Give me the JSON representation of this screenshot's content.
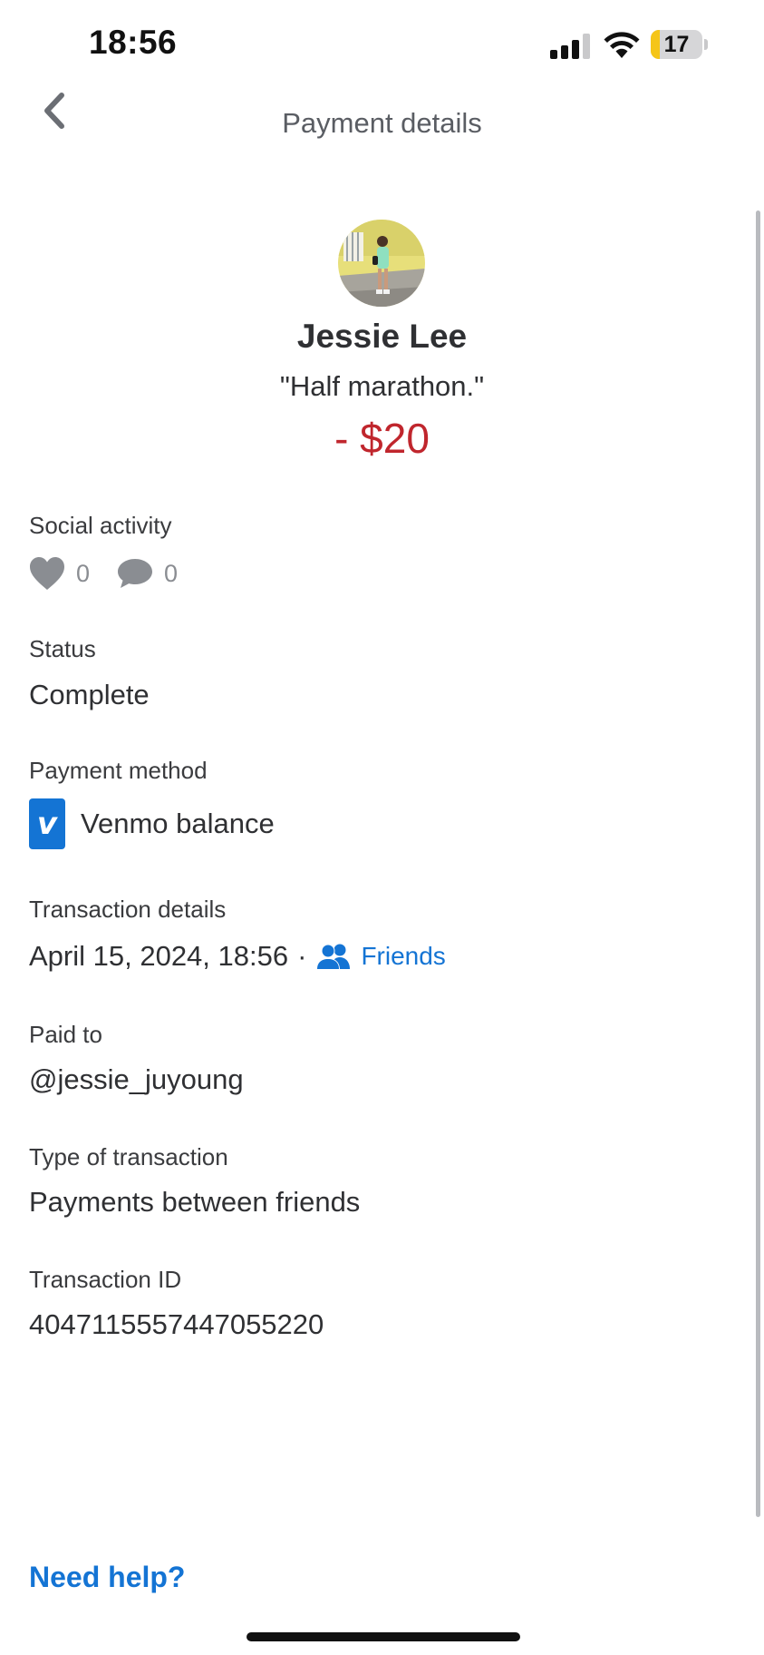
{
  "status_bar": {
    "time": "18:56",
    "battery_level": "17",
    "battery_fraction": 0.17
  },
  "header": {
    "title": "Payment details",
    "back_icon": "chevron-left-icon"
  },
  "profile": {
    "name": "Jessie Lee",
    "note": "\"Half marathon.\"",
    "amount": "- $20",
    "amount_color": "#c0262d"
  },
  "social_activity": {
    "label": "Social activity",
    "likes": "0",
    "comments": "0",
    "like_icon": "heart-icon",
    "comment_icon": "comment-bubble-icon"
  },
  "status": {
    "label": "Status",
    "value": "Complete"
  },
  "payment_method": {
    "label": "Payment method",
    "logo_letter": "v",
    "value": "Venmo balance"
  },
  "transaction_details": {
    "label": "Transaction details",
    "datetime": "April 15, 2024, 18:56",
    "separator": "·",
    "audience_icon": "friends-icon",
    "audience": "Friends"
  },
  "paid_to": {
    "label": "Paid to",
    "value": "@jessie_juyoung"
  },
  "transaction_type": {
    "label": "Type of transaction",
    "value": "Payments between friends"
  },
  "transaction_id": {
    "label": "Transaction ID",
    "value": "4047115557447055220"
  },
  "footer": {
    "help_label": "Need help?"
  },
  "colors": {
    "accent_blue": "#1474d4",
    "negative_red": "#c0262d",
    "icon_gray": "#8a8d92"
  }
}
